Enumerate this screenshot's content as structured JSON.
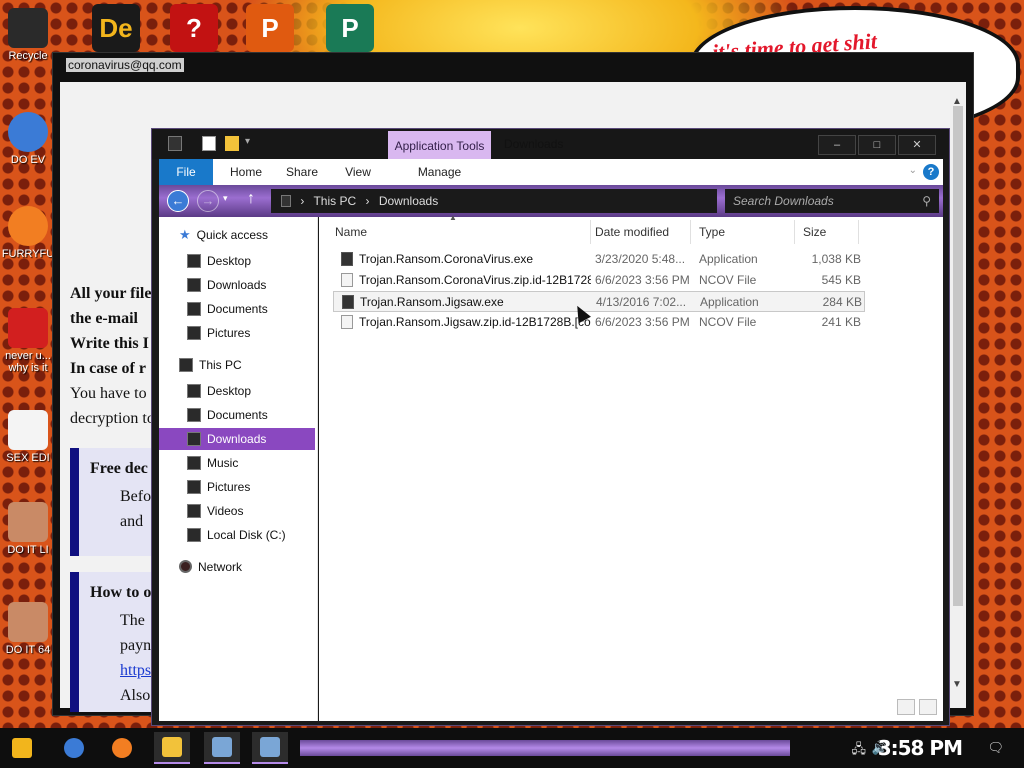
{
  "desktop": {
    "speech_text": "it's time to get shit",
    "left_icons": [
      {
        "label": "Recycle",
        "glyph": "bin-icon",
        "color": "#2a2a2a"
      },
      {
        "label": "DO EV",
        "glyph": "chrome-icon",
        "color": "#3b7bd6"
      },
      {
        "label": "FURRYFU",
        "glyph": "firefox-icon",
        "color": "#f27e22"
      },
      {
        "label": "never u... why is it",
        "glyph": "devcpp-icon",
        "color": "#d21f1f"
      },
      {
        "label": "SEX EDI",
        "glyph": "hx-icon",
        "color": "#f4f4f4"
      },
      {
        "label": "DO IT LI",
        "glyph": "portrait-icon",
        "color": "#c98a66"
      },
      {
        "label": "DO IT 64",
        "glyph": "portrait-icon",
        "color": "#c98a66"
      }
    ],
    "top_icons": [
      {
        "name": "de-icon",
        "glyph": "De",
        "color": "#1a1a1a"
      },
      {
        "name": "question-icon",
        "glyph": "?",
        "color": "#c21212"
      },
      {
        "name": "p-logo-icon",
        "glyph": "P",
        "color": "#e05a10"
      },
      {
        "name": "publisher-icon",
        "glyph": "P",
        "color": "#1a7a56"
      }
    ]
  },
  "background_window": {
    "email": "coronavirus@qq.com",
    "lines": [
      {
        "text": "All your file",
        "bold": true
      },
      {
        "text": "the e-mail",
        "bold": true
      },
      {
        "text": "Write this I",
        "bold": true
      },
      {
        "text": "In case of r",
        "bold": true
      },
      {
        "text": "You have to",
        "bold": false
      },
      {
        "text": "decryption to",
        "bold": false
      }
    ],
    "box1": {
      "title": "Free dec",
      "lines": [
        "Befo",
        "and"
      ]
    },
    "box2": {
      "title": "How to o",
      "lines": [
        "The",
        "payn",
        "https",
        "Also"
      ]
    }
  },
  "explorer": {
    "context_tab": "Application Tools",
    "title": "Downloads",
    "window_buttons": {
      "minimize": "–",
      "maximize": "□",
      "close": "✕"
    },
    "ribbon_tabs": [
      "File",
      "Home",
      "Share",
      "View",
      "Manage"
    ],
    "help": "?",
    "address": {
      "path": [
        "This PC",
        "Downloads"
      ],
      "separator": "›"
    },
    "search_placeholder": "Search Downloads",
    "nav": [
      {
        "label": "Quick access",
        "kind": "star",
        "pinned": false,
        "indent": 0
      },
      {
        "label": "Desktop",
        "kind": "folder",
        "pinned": true,
        "indent": 1
      },
      {
        "label": "Downloads",
        "kind": "folder",
        "pinned": true,
        "indent": 1
      },
      {
        "label": "Documents",
        "kind": "folder",
        "pinned": true,
        "indent": 1
      },
      {
        "label": "Pictures",
        "kind": "folder",
        "pinned": true,
        "indent": 1
      },
      {
        "label": "This PC",
        "kind": "pc",
        "pinned": false,
        "indent": 0
      },
      {
        "label": "Desktop",
        "kind": "folder",
        "pinned": false,
        "indent": 1
      },
      {
        "label": "Documents",
        "kind": "folder",
        "pinned": false,
        "indent": 1
      },
      {
        "label": "Downloads",
        "kind": "folder",
        "pinned": false,
        "indent": 1,
        "selected": true
      },
      {
        "label": "Music",
        "kind": "folder",
        "pinned": false,
        "indent": 1
      },
      {
        "label": "Pictures",
        "kind": "folder",
        "pinned": false,
        "indent": 1
      },
      {
        "label": "Videos",
        "kind": "folder",
        "pinned": false,
        "indent": 1
      },
      {
        "label": "Local Disk (C:)",
        "kind": "disk",
        "pinned": false,
        "indent": 1
      },
      {
        "label": "Network",
        "kind": "network",
        "pinned": false,
        "indent": 0
      }
    ],
    "columns": [
      "Name",
      "Date modified",
      "Type",
      "Size"
    ],
    "files": [
      {
        "name": "Trojan.Ransom.CoronaVirus.exe",
        "date": "3/23/2020 5:48...",
        "type": "Application",
        "size": "1,038 KB",
        "icon": "exe"
      },
      {
        "name": "Trojan.Ransom.CoronaVirus.zip.id-12B1728...",
        "date": "6/6/2023 3:56 PM",
        "type": "NCOV File",
        "size": "545 KB",
        "icon": "file"
      },
      {
        "name": "Trojan.Ransom.Jigsaw.exe",
        "date": "4/13/2016 7:02...",
        "type": "Application",
        "size": "284 KB",
        "icon": "exe",
        "selected": true
      },
      {
        "name": "Trojan.Ransom.Jigsaw.zip.id-12B1728B.[co...",
        "date": "6/6/2023 3:56 PM",
        "type": "NCOV File",
        "size": "241 KB",
        "icon": "file"
      }
    ]
  },
  "taskbar": {
    "clock": "3:58 PM",
    "apps": [
      {
        "name": "start-icon",
        "color": "#f2b51c"
      },
      {
        "name": "chrome-icon",
        "color": "#3b7bd6"
      },
      {
        "name": "firefox-icon",
        "color": "#f27e22"
      },
      {
        "name": "explorer-icon",
        "color": "#f2c23a"
      },
      {
        "name": "network-drive-icon",
        "color": "#7aa6d6"
      },
      {
        "name": "network-drive-icon",
        "color": "#7aa6d6"
      }
    ]
  }
}
